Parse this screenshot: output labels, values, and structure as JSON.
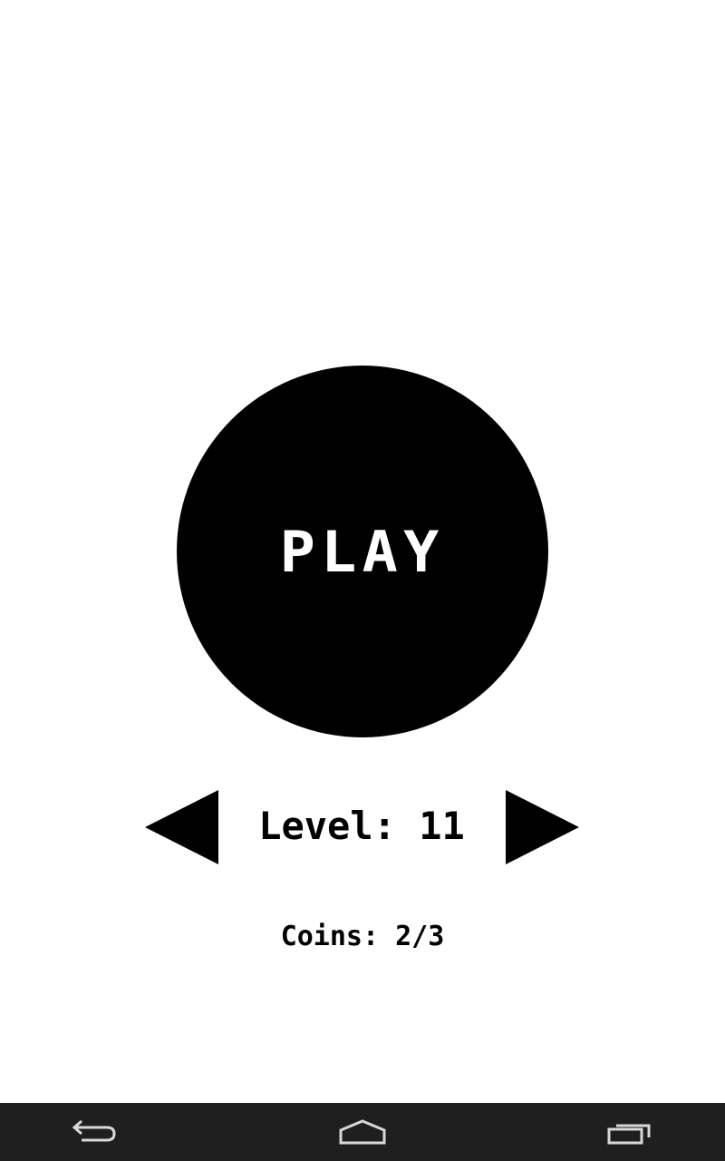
{
  "game": {
    "play_label": "PLAY",
    "level_text": "Level: 11",
    "coins_text": "Coins: 2/3"
  },
  "icons": {
    "prev_level": "triangle-left-icon",
    "next_level": "triangle-right-icon",
    "back": "back-arrow-icon",
    "home": "home-icon",
    "recents": "recent-apps-icon"
  },
  "colors": {
    "background": "#ffffff",
    "foreground": "#000000",
    "nav_bar": "#1f1f1f",
    "nav_icon": "#d8d8d8"
  }
}
